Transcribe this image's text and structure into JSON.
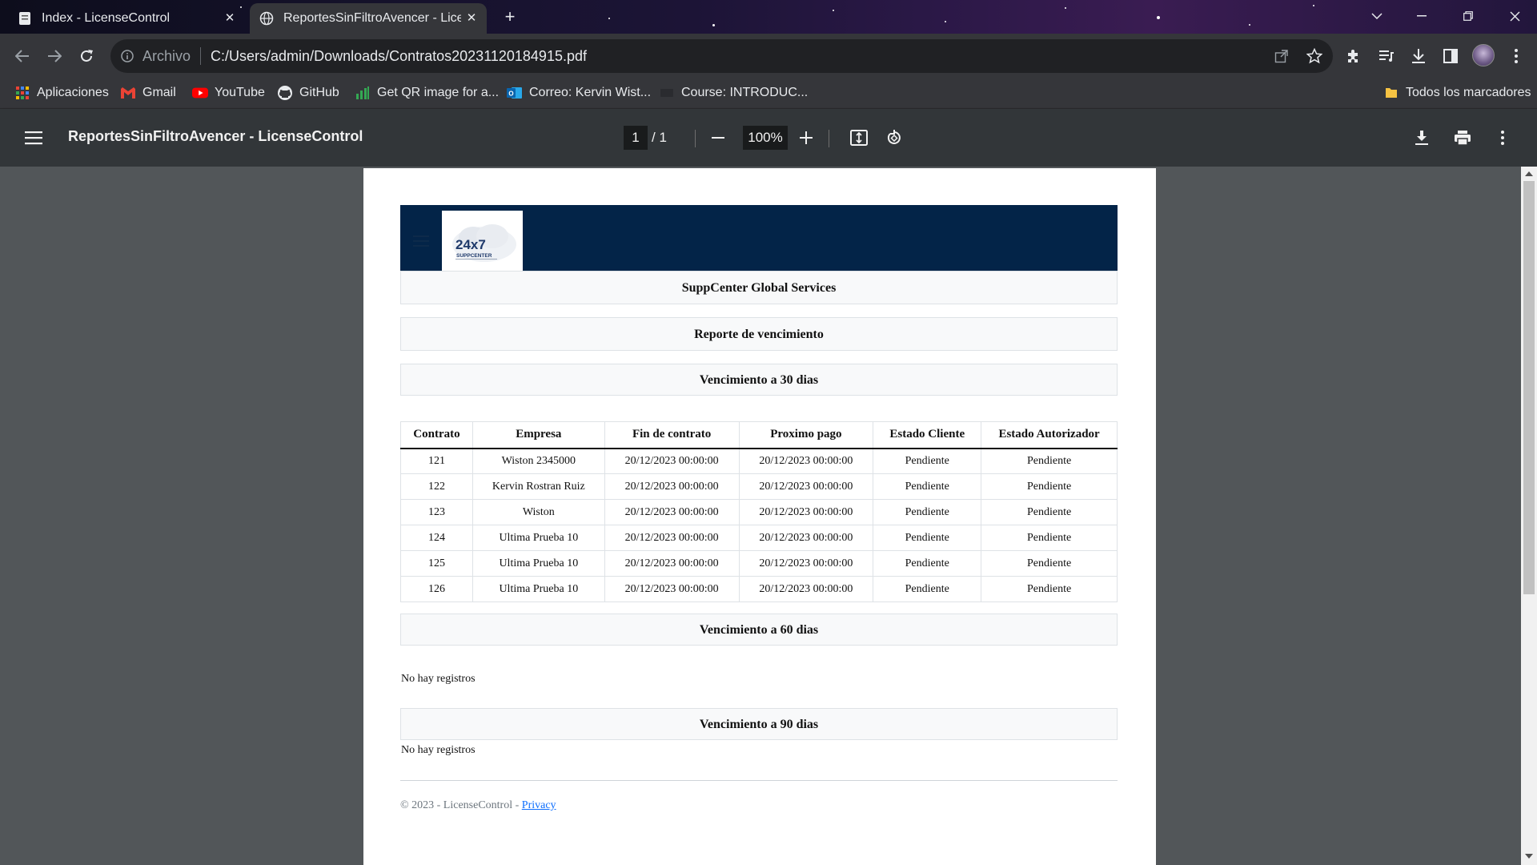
{
  "browser": {
    "tabs": [
      {
        "title": "Index - LicenseControl",
        "active": false
      },
      {
        "title": "ReportesSinFiltroAvencer - LicenseControl",
        "active": true
      }
    ],
    "address": {
      "scheme": "Archivo",
      "url": "C:/Users/admin/Downloads/Contratos20231120184915.pdf"
    },
    "bookmarks": [
      {
        "label": "Aplicaciones",
        "icon": "apps-grid-icon"
      },
      {
        "label": "Gmail",
        "icon": "gmail-icon"
      },
      {
        "label": "YouTube",
        "icon": "youtube-icon"
      },
      {
        "label": "GitHub",
        "icon": "github-icon"
      },
      {
        "label": "Get QR image for a...",
        "icon": "chart-icon"
      },
      {
        "label": "Correo: Kervin Wist...",
        "icon": "outlook-icon"
      },
      {
        "label": "Course: INTRODUC...",
        "icon": "course-icon"
      }
    ],
    "all_bookmarks": "Todos los marcadores"
  },
  "pdf": {
    "title": "ReportesSinFiltroAvencer - LicenseControl",
    "page_current": "1",
    "page_total": "/  1",
    "zoom": "100%"
  },
  "report": {
    "company": "SuppCenter Global Services",
    "report_title": "Reporte de vencimiento",
    "section30": "Vencimiento a 30 dias",
    "columns": [
      "Contrato",
      "Empresa",
      "Fin de contrato",
      "Proximo pago",
      "Estado Cliente",
      "Estado Autorizador"
    ],
    "rows": [
      [
        "121",
        "Wiston 2345000",
        "20/12/2023 00:00:00",
        "20/12/2023 00:00:00",
        "Pendiente",
        "Pendiente"
      ],
      [
        "122",
        "Kervin Rostran Ruiz",
        "20/12/2023 00:00:00",
        "20/12/2023 00:00:00",
        "Pendiente",
        "Pendiente"
      ],
      [
        "123",
        "Wiston",
        "20/12/2023 00:00:00",
        "20/12/2023 00:00:00",
        "Pendiente",
        "Pendiente"
      ],
      [
        "124",
        "Ultima Prueba 10",
        "20/12/2023 00:00:00",
        "20/12/2023 00:00:00",
        "Pendiente",
        "Pendiente"
      ],
      [
        "125",
        "Ultima Prueba 10",
        "20/12/2023 00:00:00",
        "20/12/2023 00:00:00",
        "Pendiente",
        "Pendiente"
      ],
      [
        "126",
        "Ultima Prueba 10",
        "20/12/2023 00:00:00",
        "20/12/2023 00:00:00",
        "Pendiente",
        "Pendiente"
      ]
    ],
    "section60": "Vencimiento a 60 dias",
    "empty60": "No hay registros",
    "section90": "Vencimiento a 90 dias",
    "empty90": "No hay registros",
    "footer_text": "© 2023 - LicenseControl - ",
    "footer_link": "Privacy",
    "logo_text": "24x7",
    "logo_sub": "SUPPCENTER"
  }
}
